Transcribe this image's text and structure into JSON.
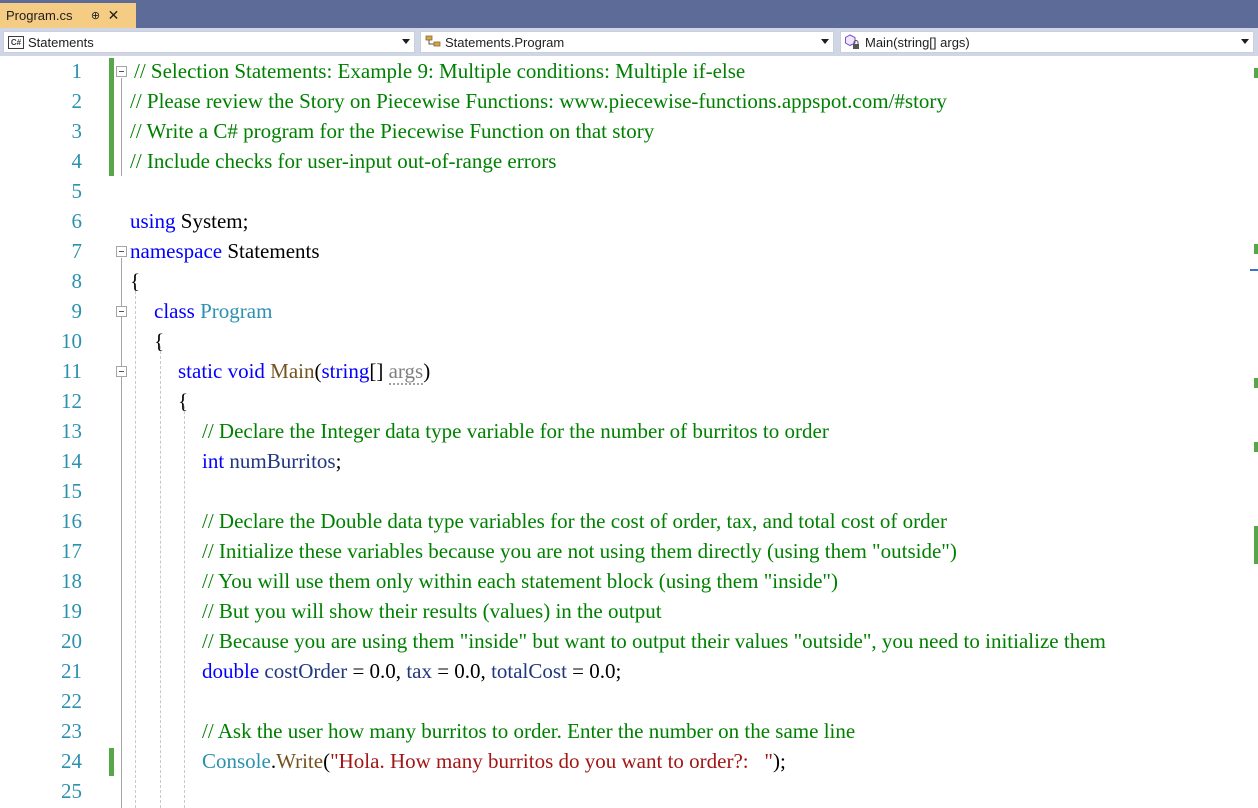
{
  "tab": {
    "title": "Program.cs",
    "pin_glyph": "⊕",
    "close_glyph": "✕"
  },
  "nav": {
    "project": "Statements",
    "cs_badge": "C#",
    "class": "Statements.Program",
    "member": "Main(string[] args)"
  },
  "line_numbers": [
    "1",
    "2",
    "3",
    "4",
    "5",
    "6",
    "7",
    "8",
    "9",
    "10",
    "11",
    "12",
    "13",
    "14",
    "15",
    "16",
    "17",
    "18",
    "19",
    "20",
    "21",
    "22",
    "23",
    "24",
    "25"
  ],
  "code": {
    "l1": "// Selection Statements: Example 9: Multiple conditions: Multiple if-else",
    "l2": "// Please review the Story on Piecewise Functions: www.piecewise-functions.appspot.com/#story",
    "l3": "// Write a C# program for the Piecewise Function on that story",
    "l4": "// Include checks for user-input out-of-range errors",
    "l6_kw": "using",
    "l6_rest": " System;",
    "l7_kw": "namespace",
    "l7_rest": " Statements",
    "l8": "{",
    "l9_kw": "class",
    "l9_type": " Program",
    "l10": "{",
    "l11_kw": "static void",
    "l11_method": " Main",
    "l11_p1": "(",
    "l11_kw2": "string",
    "l11_p2": "[] ",
    "l11_arg": "args",
    "l11_p3": ")",
    "l12": "{",
    "l13": "// Declare the Integer data type variable for the number of burritos to order",
    "l14_kw": "int",
    "l14_var": " numBurritos",
    "l14_end": ";",
    "l16": "// Declare the Double data type variables for the cost of order, tax, and total cost of order",
    "l17": "// Initialize these variables because you are not using them directly (using them \"outside\")",
    "l18": "// You will use them only within each statement block (using them \"inside\")",
    "l19": "// But you will show their results (values) in the output",
    "l20": "// Because you are using them \"inside\" but want to output their values \"outside\", you need to initialize them",
    "l21_kw": "double",
    "l21_v1": " costOrder",
    "l21_p1": " = 0.0, ",
    "l21_v2": "tax",
    "l21_p2": " = 0.0, ",
    "l21_v3": "totalCost",
    "l21_p3": " = 0.0;",
    "l23": "// Ask the user how many burritos to order. Enter the number on the same line",
    "l24_type": "Console",
    "l24_dot": ".",
    "l24_method": "Write",
    "l24_p1": "(",
    "l24_str": "\"Hola. How many burritos do you want to order?:   \"",
    "l24_p2": ");"
  },
  "colors": {
    "keyword": "#0000ff",
    "type": "#2b91af",
    "comment": "#008000",
    "string": "#a31515",
    "method": "#74531f",
    "variable": "#1f377f",
    "tab_active": "#f5cc84",
    "tabbar": "#5d6b99",
    "change_marker": "#57a64a"
  },
  "icons": {
    "pin": "pin-icon",
    "close": "close-icon",
    "cs": "csharp-file-icon",
    "class": "class-icon",
    "method": "method-icon"
  }
}
